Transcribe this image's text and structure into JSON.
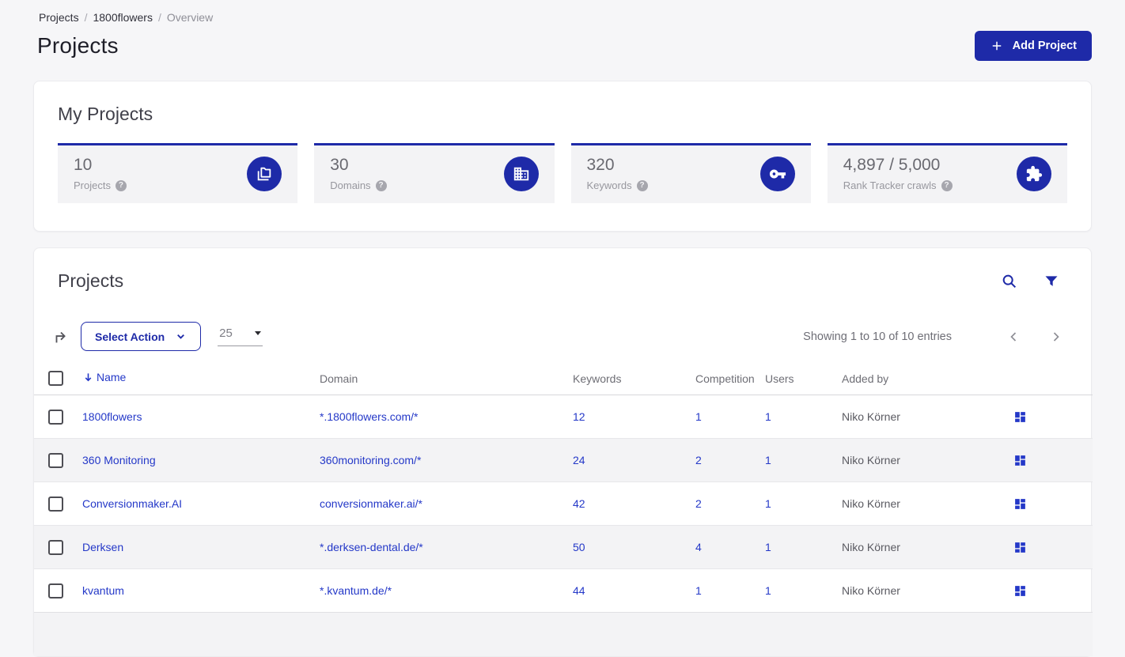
{
  "colors": {
    "primary": "#1e2aa8",
    "link": "#2438c8"
  },
  "misc": {
    "help_glyph": "?"
  },
  "breadcrumb": {
    "separator": "/",
    "items": [
      {
        "label": "Projects"
      },
      {
        "label": "1800flowers"
      },
      {
        "label": "Overview"
      }
    ]
  },
  "page": {
    "title": "Projects",
    "add_project_label": "Add Project"
  },
  "stats_card": {
    "title": "My Projects",
    "stats": [
      {
        "value": "10",
        "label": "Projects",
        "icon": "projects-folders-icon"
      },
      {
        "value": "30",
        "label": "Domains",
        "icon": "domains-building-icon"
      },
      {
        "value": "320",
        "label": "Keywords",
        "icon": "keywords-key-icon"
      },
      {
        "value": "4,897 / 5,000",
        "label": "Rank Tracker crawls",
        "icon": "crawls-puzzle-icon"
      }
    ]
  },
  "projects_card": {
    "title": "Projects",
    "toolbar": {
      "select_action_label": "Select Action",
      "page_size": "25",
      "showing_text": "Showing 1 to 10 of 10 entries"
    },
    "table": {
      "headers": {
        "name": "Name",
        "domain": "Domain",
        "keywords": "Keywords",
        "competition": "Competition",
        "users": "Users",
        "added_by": "Added by"
      },
      "rows": [
        {
          "name": "1800flowers",
          "domain": "*.1800flowers.com/*",
          "keywords": "12",
          "competition": "1",
          "users": "1",
          "added_by": "Niko Körner"
        },
        {
          "name": "360 Monitoring",
          "domain": "360monitoring.com/*",
          "keywords": "24",
          "competition": "2",
          "users": "1",
          "added_by": "Niko Körner"
        },
        {
          "name": "Conversionmaker.AI",
          "domain": "conversionmaker.ai/*",
          "keywords": "42",
          "competition": "2",
          "users": "1",
          "added_by": "Niko Körner"
        },
        {
          "name": "Derksen",
          "domain": "*.derksen-dental.de/*",
          "keywords": "50",
          "competition": "4",
          "users": "1",
          "added_by": "Niko Körner"
        },
        {
          "name": "kvantum",
          "domain": "*.kvantum.de/*",
          "keywords": "44",
          "competition": "1",
          "users": "1",
          "added_by": "Niko Körner"
        }
      ]
    }
  }
}
